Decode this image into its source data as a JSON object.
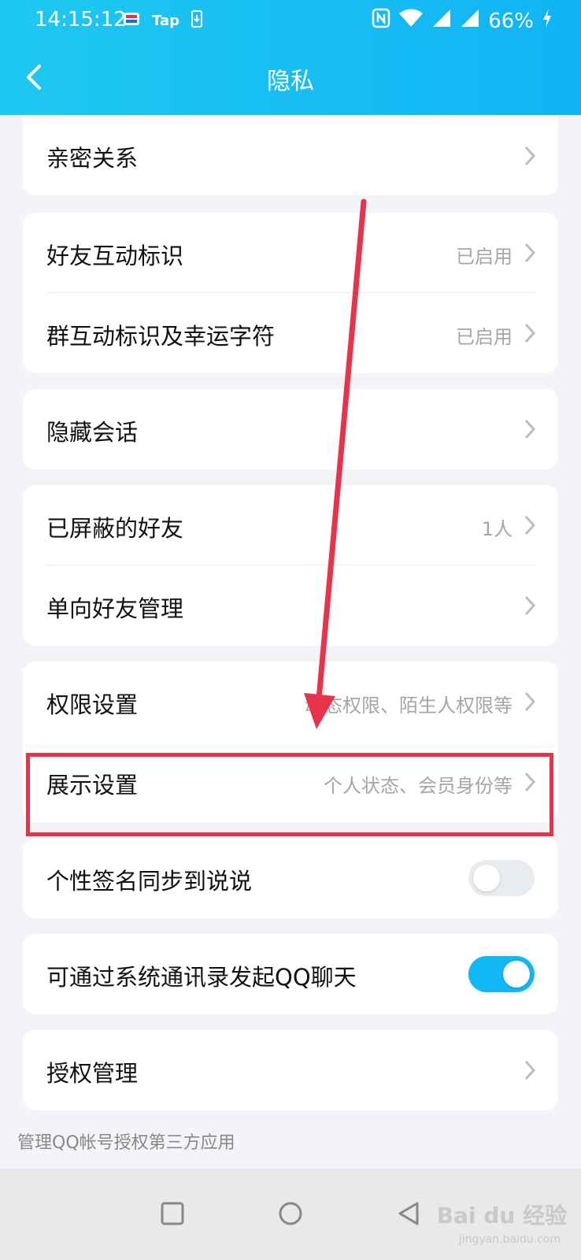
{
  "status_bar": {
    "time": "14:15:12",
    "left_icons": [
      "app-icon",
      "tap-app-icon",
      "download-icon"
    ],
    "tap_label": "Tap",
    "battery": "66%"
  },
  "header": {
    "title": "隐私",
    "color": "#12b7f5"
  },
  "groups": [
    {
      "rows": [
        {
          "label": "亲密关系",
          "value": ""
        }
      ]
    },
    {
      "rows": [
        {
          "label": "好友互动标识",
          "value": "已启用"
        },
        {
          "label": "群互动标识及幸运字符",
          "value": "已启用"
        }
      ]
    },
    {
      "rows": [
        {
          "label": "隐藏会话",
          "value": ""
        }
      ]
    },
    {
      "rows": [
        {
          "label": "已屏蔽的好友",
          "value": "1人"
        },
        {
          "label": "单向好友管理",
          "value": ""
        }
      ]
    },
    {
      "rows": [
        {
          "label": "权限设置",
          "value": "动态权限、陌生人权限等"
        },
        {
          "label": "展示设置",
          "value": "个人状态、会员身份等"
        }
      ]
    },
    {
      "rows": [
        {
          "label": "个性签名同步到说说",
          "toggle": false
        }
      ]
    },
    {
      "rows": [
        {
          "label": "可通过系统通讯录发起QQ聊天",
          "toggle": true
        }
      ]
    },
    {
      "rows": [
        {
          "label": "授权管理",
          "value": ""
        }
      ]
    }
  ],
  "footnote": "管理QQ帐号授权第三方应用",
  "annotation": {
    "highlight_color": "#e8334a",
    "highlighted_row": "展示设置"
  },
  "nav_bar": {
    "buttons": [
      "recent-apps-icon",
      "home-icon",
      "back-triangle-icon"
    ]
  },
  "watermark": {
    "text": "Bai du 经验",
    "sub": "jingyan.baidu.com"
  }
}
